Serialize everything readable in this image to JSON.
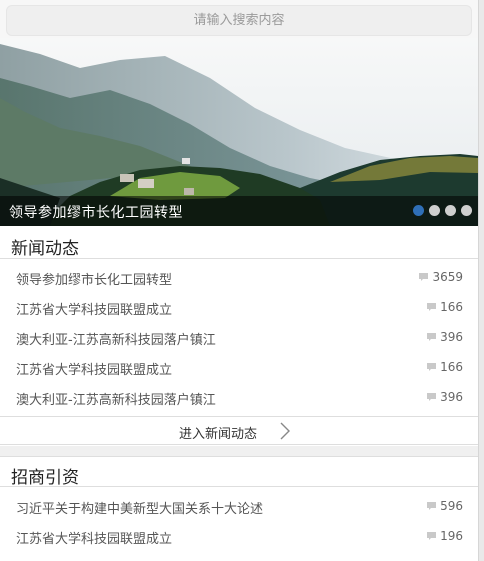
{
  "search": {
    "placeholder": "请输入搜索内容"
  },
  "banner": {
    "caption": "领导参加缪市长化工园转型",
    "slide_count": 4,
    "active_slide": 1,
    "active_dot_color": "#2f6fb7"
  },
  "news": {
    "section_title": "新闻动态",
    "items": [
      {
        "title": "领导参加缪市长化工园转型",
        "comments": "3659"
      },
      {
        "title": "江苏省大学科技园联盟成立",
        "comments": "166"
      },
      {
        "title": "澳大利亚-江苏高新科技园落户镇江",
        "comments": "396"
      },
      {
        "title": "江苏省大学科技园联盟成立",
        "comments": "166"
      },
      {
        "title": "澳大利亚-江苏高新科技园落户镇江",
        "comments": "396"
      }
    ],
    "more_label": "进入新闻动态"
  },
  "invest": {
    "section_title": "招商引资",
    "items": [
      {
        "title": "习近平关于构建中美新型大国关系十大论述",
        "comments": "596"
      },
      {
        "title": "江苏省大学科技园联盟成立",
        "comments": "196"
      }
    ]
  },
  "icons": {
    "comment": "comment-icon",
    "chevron": "chevron-right-icon"
  }
}
